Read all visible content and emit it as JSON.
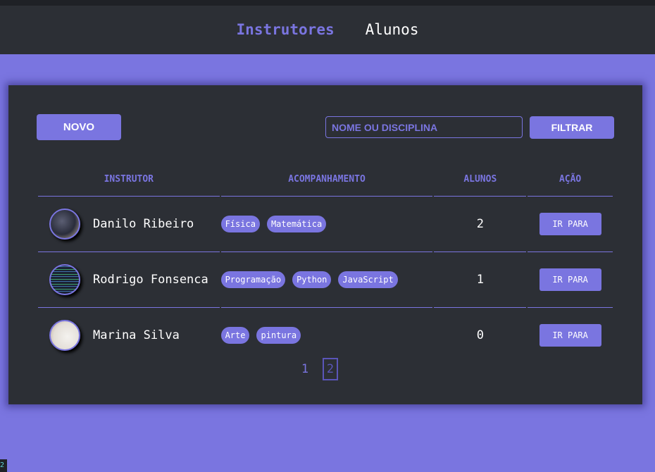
{
  "nav": {
    "instrutores": "Instrutores",
    "alunos": "Alunos"
  },
  "toolbar": {
    "novo_label": "NOVO",
    "search_placeholder": "NOME OU DISCIPLINA",
    "filtrar_label": "FILTRAR"
  },
  "table": {
    "headers": [
      "INSTRUTOR",
      "ACOMPANHAMENTO",
      "ALUNOS",
      "AÇÃO"
    ],
    "rows": [
      {
        "name": "Danilo Ribeiro",
        "tags": [
          "Física",
          "Matemática"
        ],
        "alunos": "2",
        "action": "IR PARA"
      },
      {
        "name": "Rodrigo Fonsenca",
        "tags": [
          "Programação",
          "Python",
          "JavaScript"
        ],
        "alunos": "1",
        "action": "IR PARA"
      },
      {
        "name": "Marina Silva",
        "tags": [
          "Arte",
          "pintura"
        ],
        "alunos": "0",
        "action": "IR PARA"
      }
    ]
  },
  "pagination": {
    "pages": [
      "1",
      "2"
    ],
    "current": "2"
  },
  "corner_badge": "2",
  "colors": {
    "accent": "#7a75e0",
    "panel": "#2c2f35"
  }
}
